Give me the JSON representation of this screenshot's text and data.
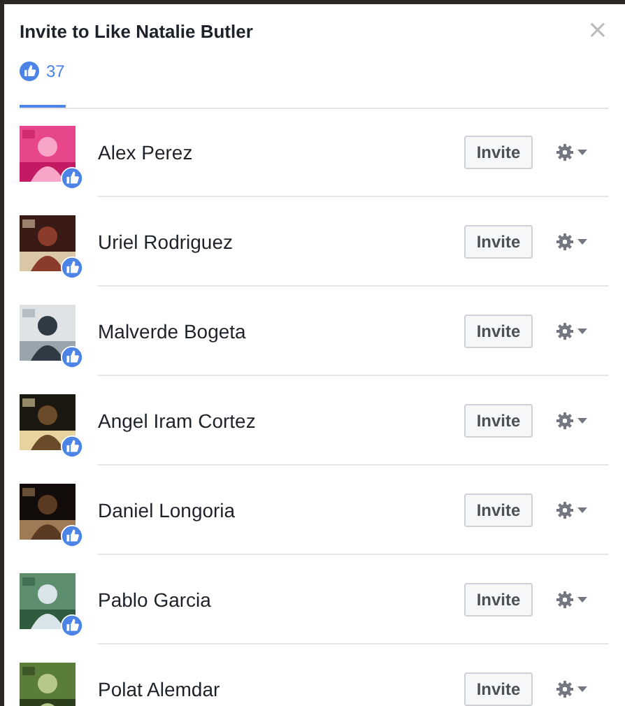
{
  "dialog": {
    "title": "Invite to Like Natalie Butler",
    "close": "×"
  },
  "tabs": [
    {
      "label": "37",
      "selected": true
    }
  ],
  "people": [
    {
      "name": "Alex Perez",
      "button": "Invite"
    },
    {
      "name": "Uriel Rodriguez",
      "button": "Invite"
    },
    {
      "name": "Malverde Bogeta",
      "button": "Invite"
    },
    {
      "name": "Angel Iram Cortez",
      "button": "Invite"
    },
    {
      "name": "Daniel Longoria",
      "button": "Invite"
    },
    {
      "name": "Pablo Garcia",
      "button": "Invite"
    },
    {
      "name": "Polat Alemdar",
      "button": "Invite"
    }
  ]
}
